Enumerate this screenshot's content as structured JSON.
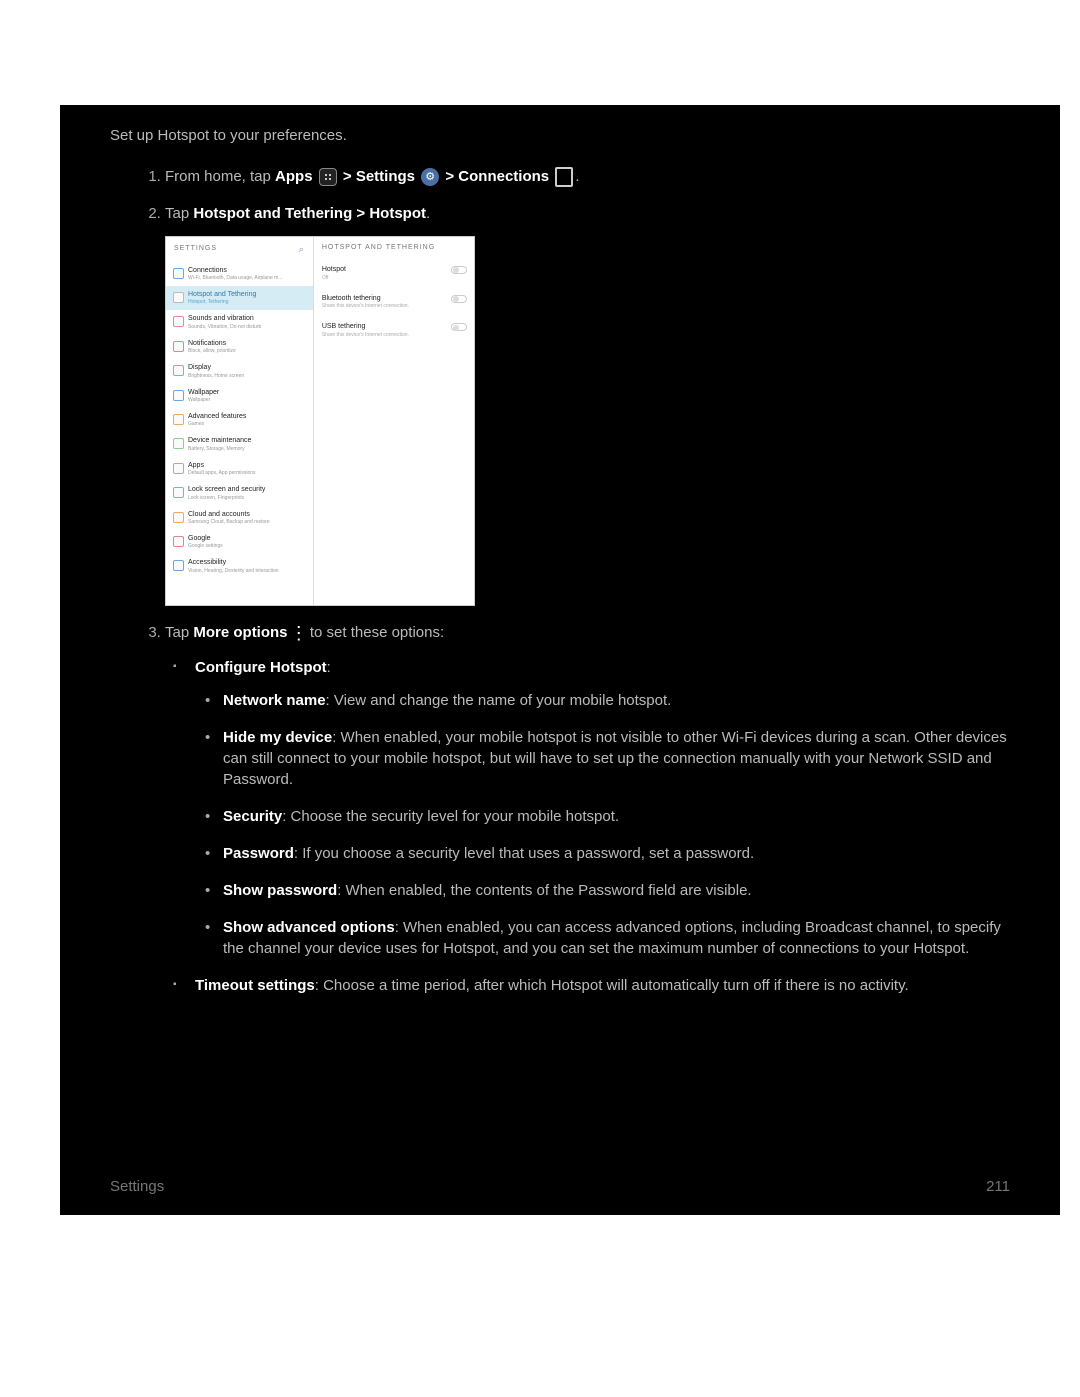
{
  "intro": "Set up Hotspot to your preferences.",
  "step1": {
    "prefix": "From home, tap ",
    "apps": "Apps",
    "gt1": " > ",
    "settings": "Settings",
    "gt2": " > ",
    "connections": "Connections",
    "period": "."
  },
  "step2": {
    "prefix": "Tap ",
    "bold": "Hotspot and Tethering > Hotspot",
    "period": "."
  },
  "shot": {
    "left_header": "SETTINGS",
    "right_header": "HOTSPOT AND TETHERING",
    "left_items": [
      {
        "t": "Connections",
        "s": "Wi-Fi, Bluetooth, Data usage, Airplane m..."
      },
      {
        "t": "Hotspot and Tethering",
        "s": "Hotspot, Tethering"
      },
      {
        "t": "Sounds and vibration",
        "s": "Sounds, Vibration, Do not disturb"
      },
      {
        "t": "Notifications",
        "s": "Block, allow, prioritize"
      },
      {
        "t": "Display",
        "s": "Brightness, Home screen"
      },
      {
        "t": "Wallpaper",
        "s": "Wallpaper"
      },
      {
        "t": "Advanced features",
        "s": "Games"
      },
      {
        "t": "Device maintenance",
        "s": "Battery, Storage, Memory"
      },
      {
        "t": "Apps",
        "s": "Default apps, App permissions"
      },
      {
        "t": "Lock screen and security",
        "s": "Lock screen, Fingerprints"
      },
      {
        "t": "Cloud and accounts",
        "s": "Samsung Cloud, Backup and restore"
      },
      {
        "t": "Google",
        "s": "Google settings"
      },
      {
        "t": "Accessibility",
        "s": "Vision, Hearing, Dexterity and interaction"
      }
    ],
    "right_items": [
      {
        "t": "Hotspot",
        "s": "Off"
      },
      {
        "t": "Bluetooth tethering",
        "s": "Share this device's Internet connection."
      },
      {
        "t": "USB tethering",
        "s": "Share this device's Internet connection."
      }
    ]
  },
  "step3": {
    "prefix": "Tap ",
    "more": "More options",
    "suffix": " to set these options:"
  },
  "configure_heading": "Configure Hotspot",
  "colon": ":",
  "opts": {
    "nn_b": "Network name",
    "nn_t": ": View and change the name of your mobile hotspot.",
    "hd_b": "Hide my device",
    "hd_t": ": When enabled, your mobile hotspot is not visible to other Wi-Fi devices during a scan. Other devices can still connect to your mobile hotspot, but will have to set up the connection manually with your Network SSID and Password.",
    "sec_b": "Security",
    "sec_t": ": Choose the security level for your mobile hotspot.",
    "pw_b": "Password",
    "pw_t": ": If you choose a security level that uses a password, set a password.",
    "sp_b": "Show password",
    "sp_t": ": When enabled, the contents of the Password field are visible.",
    "sa_b": "Show advanced options",
    "sa_t": ": When enabled, you can access advanced options, including Broadcast channel, to specify the channel your device uses for Hotspot, and you can set the maximum number of connections to your Hotspot."
  },
  "timeout_b": "Timeout settings",
  "timeout_t": ": Choose a time period, after which Hotspot will automatically turn off if there is no activity.",
  "footer_left": "Settings",
  "footer_right": "211"
}
